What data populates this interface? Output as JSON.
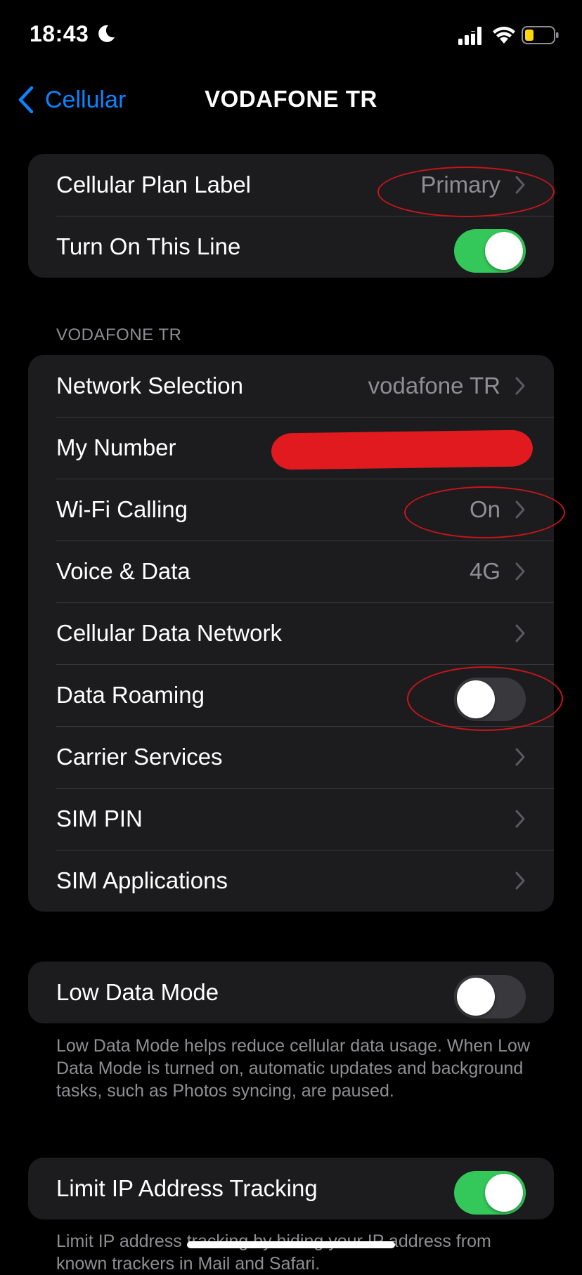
{
  "status_bar": {
    "time": "18:43",
    "battery_color": "#ffd60a"
  },
  "nav": {
    "back_label": "Cellular",
    "title": "VODAFONE TR"
  },
  "plan_group": {
    "plan_label_row": {
      "label": "Cellular Plan Label",
      "value": "Primary"
    },
    "turn_on_row": {
      "label": "Turn On This Line",
      "toggle_on": true
    }
  },
  "carrier_section": {
    "header": "VODAFONE TR",
    "rows": [
      {
        "label": "Network Selection",
        "value": "vodafone TR",
        "chevron": true
      },
      {
        "label": "My Number",
        "value": "",
        "redacted": true
      },
      {
        "label": "Wi-Fi Calling",
        "value": "On",
        "chevron": true
      },
      {
        "label": "Voice & Data",
        "value": "4G",
        "chevron": true
      },
      {
        "label": "Cellular Data Network",
        "value": "",
        "chevron": true
      },
      {
        "label": "Data Roaming",
        "toggle_on": false
      },
      {
        "label": "Carrier Services",
        "value": "",
        "chevron": true
      },
      {
        "label": "SIM PIN",
        "value": "",
        "chevron": true
      },
      {
        "label": "SIM Applications",
        "value": "",
        "chevron": true
      }
    ]
  },
  "low_data": {
    "label": "Low Data Mode",
    "toggle_on": false,
    "footnote": "Low Data Mode helps reduce cellular data usage. When Low Data Mode is turned on, automatic updates and background tasks, such as Photos syncing, are paused."
  },
  "limit_ip": {
    "label": "Limit IP Address Tracking",
    "toggle_on": true,
    "footnote": "Limit IP address tracking by hiding your IP address from known trackers in Mail and Safari."
  },
  "colors": {
    "accent": "#0A84FF",
    "toggle_on": "#34c759",
    "annotation": "#c8151b",
    "redaction": "#e11a1f"
  }
}
